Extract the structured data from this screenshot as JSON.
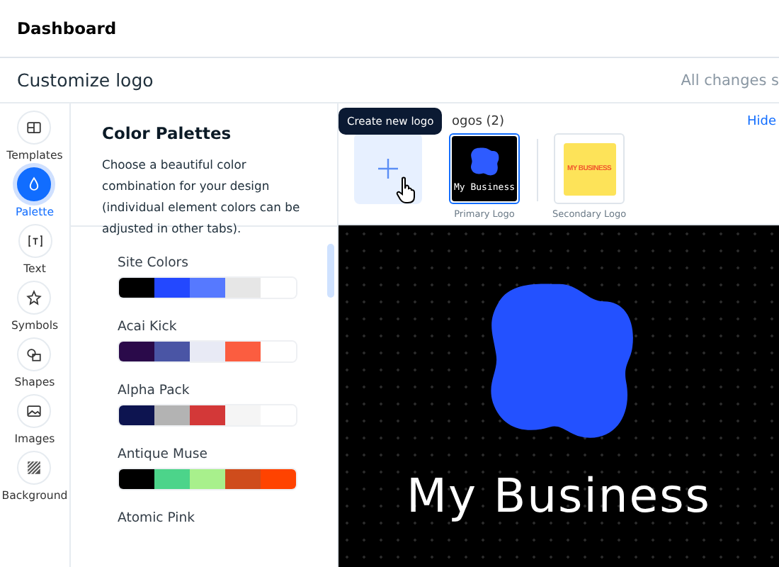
{
  "header": {
    "title": "Dashboard"
  },
  "toolbar": {
    "title": "Customize logo",
    "status": "All changes s"
  },
  "sidebar": {
    "items": [
      {
        "label": "Templates",
        "selected": false
      },
      {
        "label": "Palette",
        "selected": true
      },
      {
        "label": "Text",
        "selected": false
      },
      {
        "label": "Symbols",
        "selected": false
      },
      {
        "label": "Shapes",
        "selected": false
      },
      {
        "label": "Images",
        "selected": false
      },
      {
        "label": "Background",
        "selected": false
      }
    ]
  },
  "palette_panel": {
    "title": "Color Palettes",
    "description": "Choose a beautiful color combination for your design (individual element colors can be adjusted in other tabs).",
    "palettes": [
      {
        "name": "Site Colors",
        "swatches": [
          {
            "color": "#000000"
          },
          {
            "color": "#2348ff"
          },
          {
            "color": "#5679ff"
          },
          {
            "color": "#e6e6e6"
          },
          {
            "color": "#ffffff"
          }
        ]
      },
      {
        "name": "Acai Kick",
        "swatches": [
          {
            "color": "#2a0a4a"
          },
          {
            "color": "#4a55a5"
          },
          {
            "color": "#e8eaf5"
          },
          {
            "color": "#fb5d40"
          },
          {
            "color": "#ffffff"
          }
        ]
      },
      {
        "name": "Alpha Pack",
        "swatches": [
          {
            "color": "#0d1450"
          },
          {
            "color": "#b3b3b3"
          },
          {
            "color": "#d33838"
          },
          {
            "color": "#f5f5f5"
          },
          {
            "color": "#ffffff"
          }
        ]
      },
      {
        "name": "Antique Muse",
        "swatches": [
          {
            "color": "#000000"
          },
          {
            "color": "#4cd48a"
          },
          {
            "color": "#a8f08c"
          },
          {
            "color": "#cf4c1c"
          },
          {
            "color": "#ff4300"
          }
        ]
      },
      {
        "name": "Atomic Pink"
      }
    ]
  },
  "logos": {
    "heading": "ogos (2)",
    "hide_link": "Hide",
    "tooltip": "Create new logo",
    "items": [
      {
        "kind": "primary",
        "text": "My Business",
        "label": "Primary Logo",
        "selected": true
      },
      {
        "kind": "secondary",
        "text": "MY BUSINESS",
        "label": "Secondary Logo",
        "selected": false
      }
    ]
  },
  "preview": {
    "text": "My Business"
  }
}
